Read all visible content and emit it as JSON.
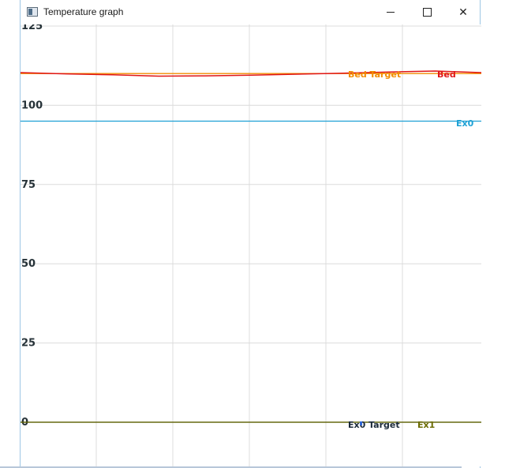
{
  "window": {
    "title": "Temperature graph",
    "controls": {
      "minimize": "minimize",
      "maximize": "maximize",
      "close": "close"
    }
  },
  "chart_data": {
    "type": "line",
    "yticks": [
      "125",
      "100",
      "75",
      "50",
      "25",
      "0"
    ],
    "ylim": [
      0,
      125
    ],
    "grid": true,
    "series": [
      {
        "name": "Bed Target",
        "color": "#f28c00",
        "values": [
          110,
          110,
          110,
          110,
          110,
          110,
          110,
          110,
          110,
          110,
          110
        ]
      },
      {
        "name": "Bed",
        "color": "#e01616",
        "values": [
          110.3,
          109.9,
          109.6,
          109.2,
          109.3,
          109.5,
          109.8,
          110.1,
          110.5,
          110.8,
          110.3
        ]
      },
      {
        "name": "Ex0",
        "color": "#1ea1d5",
        "values": [
          95,
          95,
          95,
          95,
          95,
          95,
          95,
          95,
          95,
          95,
          95
        ]
      },
      {
        "name": "Ex0 Target",
        "color": "#1b2a3a",
        "values": [
          0,
          0,
          0,
          0,
          0,
          0,
          0,
          0,
          0,
          0,
          0
        ]
      },
      {
        "name": "Ex1",
        "color": "#6b6b00",
        "values": [
          0,
          0,
          0,
          0,
          0,
          0,
          0,
          0,
          0,
          0,
          0
        ]
      }
    ],
    "ex0_target_color": "#1b2a3a",
    "ex1_color": "#6b6b00"
  }
}
